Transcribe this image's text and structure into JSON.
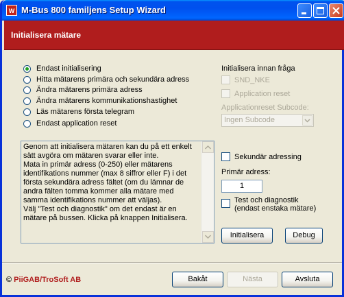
{
  "window": {
    "title": "M-Bus 800 familjens Setup Wizard",
    "icon_letter": "W"
  },
  "header": {
    "title": "Initialisera mätare"
  },
  "options": [
    {
      "label": "Endast initialisering",
      "checked": true
    },
    {
      "label": "Hitta mätarens primära och sekundära adress",
      "checked": false
    },
    {
      "label": "Ändra mätarens primära adress",
      "checked": false
    },
    {
      "label": "Ändra mätarens kommunikationshastighet",
      "checked": false
    },
    {
      "label": "Läs mätarens första telegram",
      "checked": false
    },
    {
      "label": "Endast application reset",
      "checked": false
    }
  ],
  "info_text": "Genom att initialisera mätaren kan du på ett enkelt sätt avgöra om mätaren svarar eller inte.\nMata in primär adress (0-250) eller mätarens identifikations nummer (max 8 siffror eller F) i det första sekundära adress fältet (om du lämnar de andra fälten tomma kommer alla mätare med samma identifikations nummer att väljas).\nVälj \"Test och diagnostik\" om det endast är en mätare på bussen. Klicka på knappen Initialisera.",
  "right": {
    "init_before_label": "Initialisera innan fråga",
    "snd_nke_label": "SND_NKE",
    "app_reset_label": "Application reset",
    "subcode_label": "Applicationreset Subcode:",
    "subcode_value": "Ingen Subcode",
    "secondary_label": "Sekundär adressing",
    "primary_label": "Primär adress:",
    "primary_value": "1",
    "test_label_line1": "Test och diagnostik",
    "test_label_line2": "(endast enstaka mätare)",
    "init_button": "Initialisera",
    "debug_button": "Debug"
  },
  "footer": {
    "copyright_symbol": "©",
    "brand": "PiiGAB/TroSoft AB",
    "back_button": "Bakåt",
    "next_button": "Nästa",
    "cancel_button": "Avsluta"
  },
  "colors": {
    "header_band": "#b01d1d",
    "title_bar": "#0053ee",
    "radio_dot": "#21a121"
  }
}
